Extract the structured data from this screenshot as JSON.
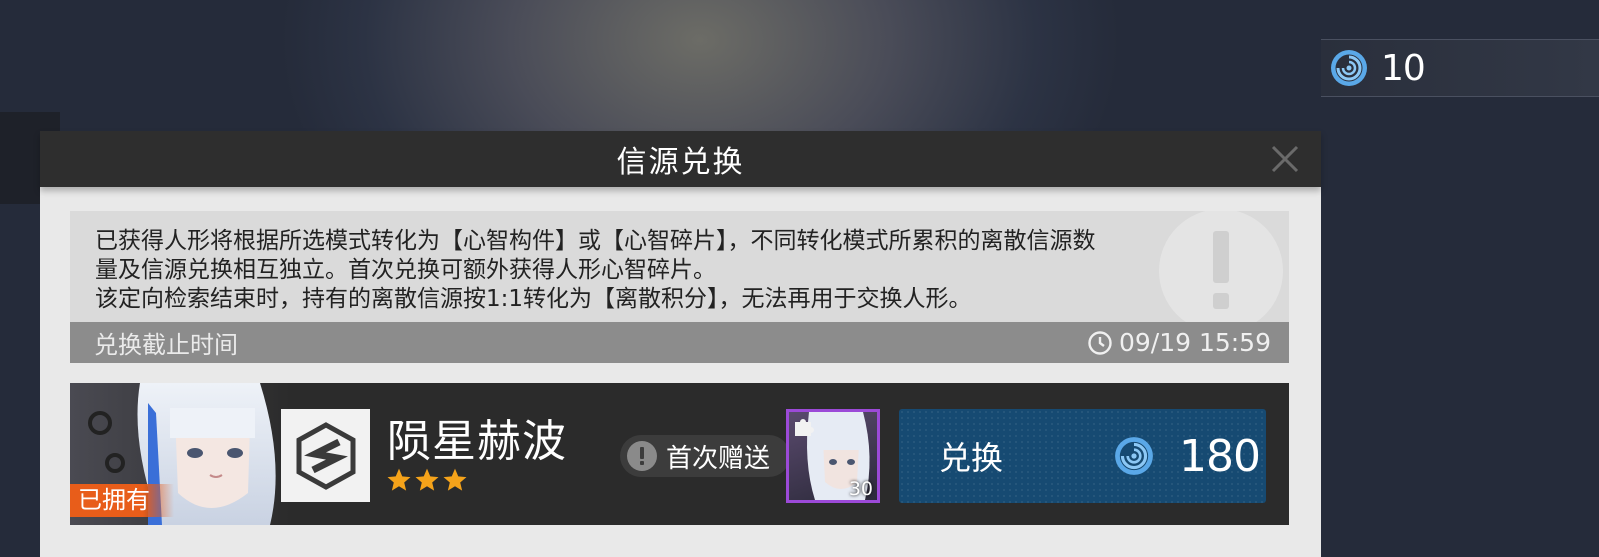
{
  "currency": {
    "icon": "signal-coin-icon",
    "amount": "10"
  },
  "dialog": {
    "title": "信源兑换",
    "info_lines": [
      "已获得人形将根据所选模式转化为【心智构件】或【心智碎片】，不同转化模式所累积的离散信源数",
      "量及信源兑换相互独立。首次兑换可额外获得人形心智碎片。",
      "该定向检索结束时，持有的离散信源按1:1转化为【离散积分】，无法再用于交换人形。"
    ],
    "deadline_label": "兑换截止时间",
    "deadline_time": "09/19 15:59"
  },
  "item": {
    "owned_badge": "已拥有",
    "name": "陨星赫波",
    "stars": 3,
    "first_gift_label": "首次赠送",
    "gift_count": "30",
    "exchange_label": "兑换",
    "cost": "180"
  },
  "colors": {
    "accent_orange": "#e85d1a",
    "button_blue": "#164a72",
    "star": "#f5a31a",
    "gift_border": "#9c4ad8"
  }
}
